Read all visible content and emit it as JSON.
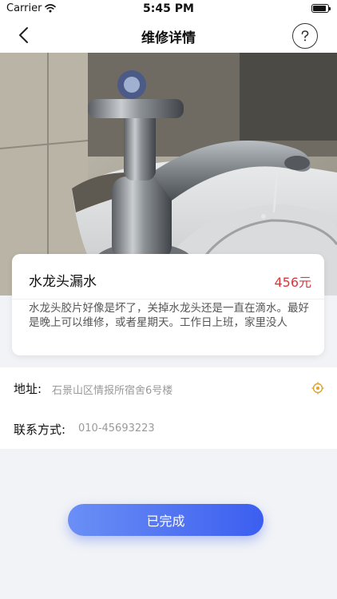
{
  "status_bar": {
    "carrier": "Carrier",
    "time": "5:45 PM",
    "battery_level": 0.9
  },
  "nav": {
    "title": "维修详情",
    "back_icon": "chevron-left-icon",
    "help_icon": "question-circle-icon"
  },
  "hero": {
    "icon": "faucet-photo"
  },
  "item": {
    "title": "水龙头漏水",
    "price": "456元",
    "description": "水龙头胶片好像是坏了，关掉水龙头还是一直在滴水。最好是晚上可以维修，或者星期天。工作日上班，家里没人"
  },
  "address": {
    "label": "地址:",
    "value": "石景山区情报所宿舍6号楼",
    "icon": "locate-icon"
  },
  "contact": {
    "label": "联系方式:",
    "value": "010-45693223"
  },
  "action": {
    "label": "已完成"
  },
  "colors": {
    "accent": "#4a6cf2",
    "price": "#e0343b"
  }
}
